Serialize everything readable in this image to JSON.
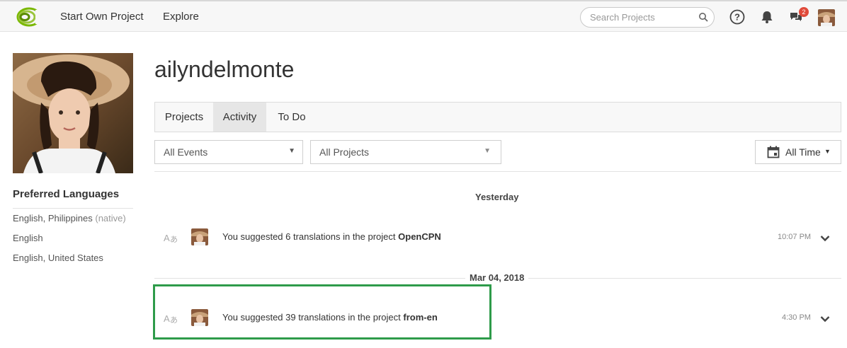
{
  "nav": {
    "logo_icon": "crowdin-logo-icon",
    "links": [
      "Start Own Project",
      "Explore"
    ],
    "search_placeholder": "Search Projects",
    "help_icon": "help-circle-icon",
    "bell_icon": "bell-icon",
    "messages_icon": "messages-icon",
    "messages_count": "2"
  },
  "sidebar": {
    "pref_title": "Preferred Languages",
    "languages": [
      {
        "name": "English, Philippines",
        "note": "(native)"
      },
      {
        "name": "English",
        "note": ""
      },
      {
        "name": "English, United States",
        "note": ""
      }
    ]
  },
  "profile": {
    "username": "ailyndelmonte"
  },
  "tabs": [
    "Projects",
    "Activity",
    "To Do"
  ],
  "active_tab": "Activity",
  "filters": {
    "events": "All Events",
    "projects": "All Projects",
    "time": "All Time"
  },
  "activity": {
    "groups": [
      {
        "date": "Yesterday",
        "items": [
          {
            "prefix": "You suggested 6 translations in the project ",
            "project": "OpenCPN",
            "time": "10:07 PM"
          }
        ]
      },
      {
        "date": "Mar 04, 2018",
        "items": [
          {
            "prefix": "You suggested 39 translations in the project ",
            "project": "from-en",
            "time": "4:30 PM"
          }
        ]
      }
    ]
  },
  "colors": {
    "highlight": "#2e9b4a",
    "badge": "#e04a3a",
    "logo": "#7ab800"
  }
}
